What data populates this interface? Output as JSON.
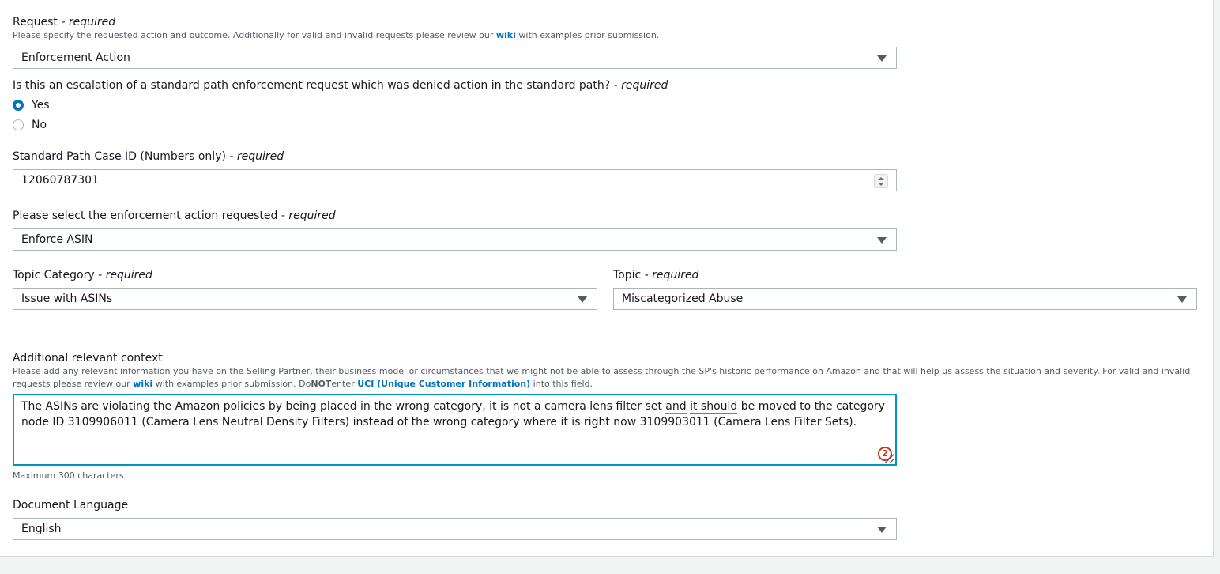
{
  "request": {
    "label": "Request",
    "required": "- required",
    "desc_before": "Please specify the requested action and outcome. Additionally for valid and invalid requests please review our ",
    "desc_link": "wiki",
    "desc_after": " with examples prior submission.",
    "value": "Enforcement Action"
  },
  "escalation": {
    "label": "Is this an escalation of a standard path enforcement request which was denied action in the standard path?",
    "required": "- required",
    "options": [
      "Yes",
      "No"
    ],
    "selected": "Yes"
  },
  "case_id": {
    "label": "Standard Path Case ID (Numbers only)",
    "required": "- required",
    "value": "12060787301"
  },
  "enforcement_action": {
    "label": "Please select the enforcement action requested",
    "required": "- required",
    "value": "Enforce ASIN"
  },
  "topic_category": {
    "label": "Topic Category",
    "required": "- required",
    "value": "Issue with ASINs"
  },
  "topic": {
    "label": "Topic",
    "required": "- required",
    "value": "Miscategorized Abuse"
  },
  "context": {
    "label": "Additional relevant context",
    "desc_1": "Please add any relevant information you have on the Selling Partner, their business model or circumstances that we might not be able to assess through the SP's historic performance on Amazon and that will help us assess the situation and severity. For valid and invalid",
    "desc_2_before": "requests please review our ",
    "desc_2_link": "wiki",
    "desc_2_mid": " with examples prior submission. Do",
    "desc_2_not": "NOT",
    "desc_2_enter": "enter ",
    "desc_2_uci": "UCI (Unique Customer Information)",
    "desc_2_after": " into this field.",
    "text_1": "The ASINs are violating the Amazon policies by being placed in the wrong category, it is not a camera lens filter set ",
    "text_and": "and",
    "text_space": " ",
    "text_should": "it should",
    "text_2": " be moved to the category node ID 3109906011 (Camera Lens Neutral Density Filters) instead of the wrong category where it is right now 3109903011 (Camera Lens Filter Sets).",
    "badge_count": "2",
    "hint": "Maximum 300 characters"
  },
  "language": {
    "label": "Document Language",
    "value": "English"
  },
  "icons": {
    "dropdown": "caret-down-icon",
    "stepper": "stepper-icon",
    "grammar": "grammar-badge-icon",
    "resize": "resize-grip-icon"
  },
  "colors": {
    "link": "#0073bb",
    "focus": "#0093c4",
    "badge": "#d13212"
  }
}
